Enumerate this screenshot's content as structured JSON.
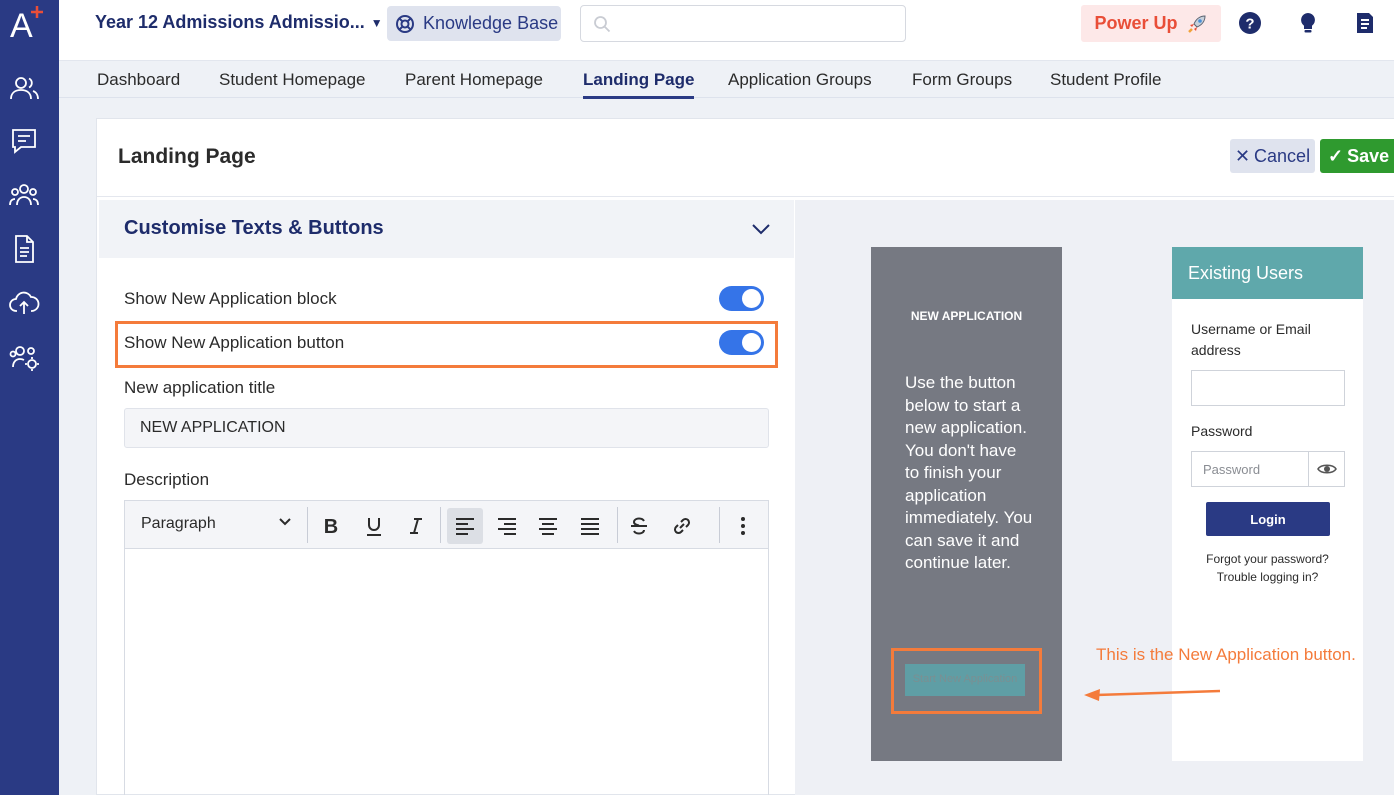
{
  "app": {
    "logo_letter": "A",
    "school_name": "Year 12 Admissions Admissio...",
    "knowledge_base_label": "Knowledge Base",
    "search_placeholder": "",
    "power_up_label": "Power Up"
  },
  "sidebar": {
    "icons": [
      "people-icon",
      "chat-icon",
      "group-icon",
      "document-icon",
      "cloud-upload-icon",
      "users-settings-icon"
    ]
  },
  "tabs": [
    {
      "label": "Dashboard",
      "active": false
    },
    {
      "label": "Student Homepage",
      "active": false
    },
    {
      "label": "Parent Homepage",
      "active": false
    },
    {
      "label": "Landing Page",
      "active": true
    },
    {
      "label": "Application Groups",
      "active": false
    },
    {
      "label": "Form Groups",
      "active": false
    },
    {
      "label": "Student Profile",
      "active": false
    }
  ],
  "page": {
    "title": "Landing Page",
    "cancel_label": "Cancel",
    "save_label": "Save"
  },
  "settings": {
    "section_title": "Customise Texts & Buttons",
    "show_block_label": "Show New Application block",
    "show_block_on": true,
    "show_button_label": "Show New Application button",
    "show_button_on": true,
    "title_field_label": "New application title",
    "title_field_value": "NEW APPLICATION",
    "description_label": "Description",
    "editor_block_format": "Paragraph"
  },
  "preview": {
    "new_app_title": "NEW APPLICATION",
    "new_app_description": "Use the button below to start a new application. You don't have to finish your application immediately. You can save it and continue later.",
    "start_button_label": "Start New Application",
    "existing_users_title": "Existing Users",
    "username_label": "Username or Email address",
    "username_value": "",
    "password_label": "Password",
    "password_placeholder": "Password",
    "login_label": "Login",
    "forgot_password": "Forgot your password?",
    "trouble_logging_in": "Trouble logging in?"
  },
  "annotation": {
    "text": "This is the New Application button."
  },
  "colors": {
    "sidebar": "#2a3a84",
    "accent_navy": "#1e2c6b",
    "power_up": "#e94e38",
    "save_green": "#2f9a2f",
    "toggle_blue": "#3574e8",
    "highlight_orange": "#f47b3b",
    "teal": "#5fa8ab",
    "new_app_gray": "#767982"
  }
}
